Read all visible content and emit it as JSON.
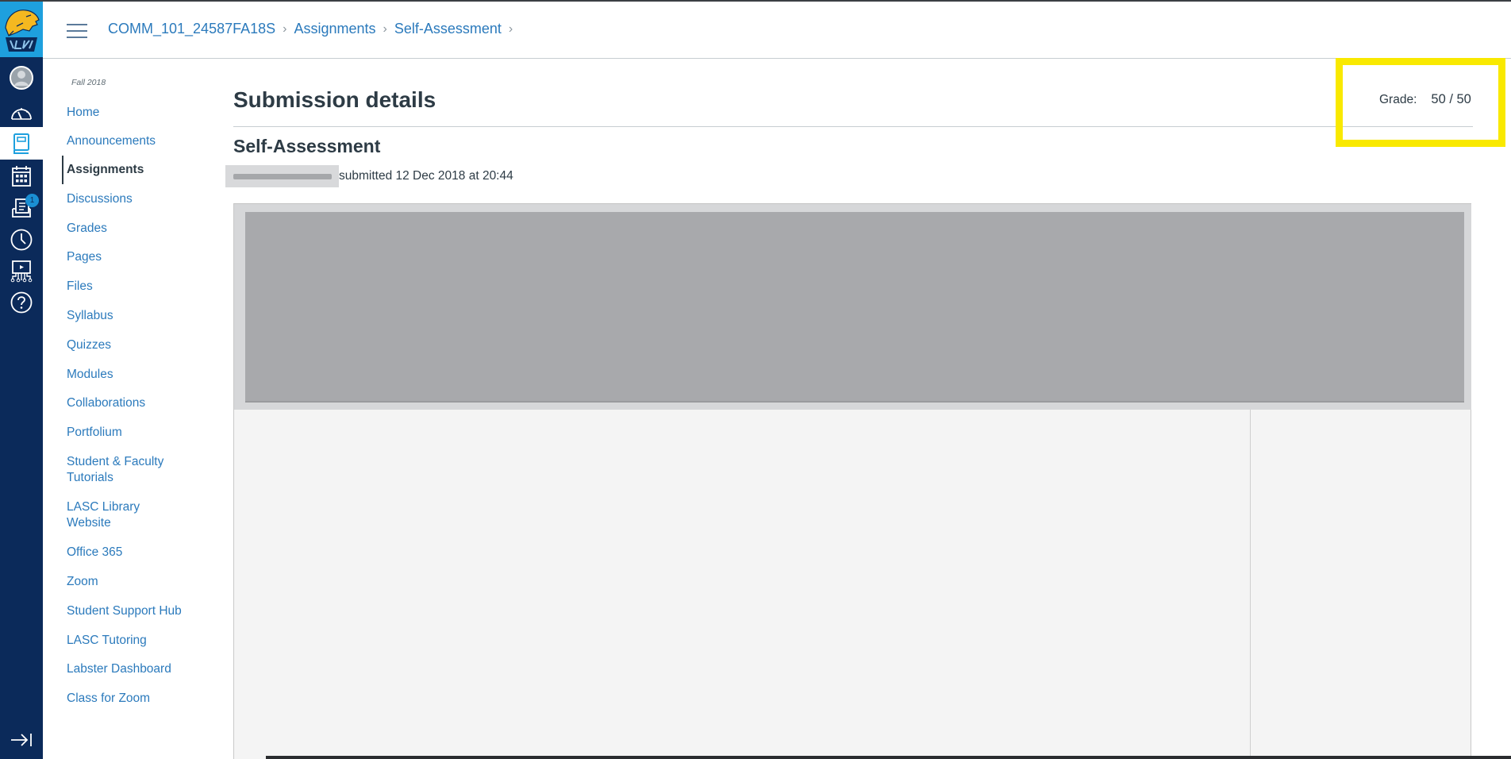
{
  "global_nav": {
    "logo_alt": "LASC logo",
    "items": [
      {
        "name": "account",
        "icon": "user-avatar-icon"
      },
      {
        "name": "dashboard",
        "icon": "speedometer-icon"
      },
      {
        "name": "courses",
        "icon": "book-icon",
        "active": true
      },
      {
        "name": "calendar",
        "icon": "calendar-icon"
      },
      {
        "name": "inbox",
        "icon": "inbox-icon",
        "badge": "1"
      },
      {
        "name": "history",
        "icon": "clock-icon"
      },
      {
        "name": "commons",
        "icon": "presentation-network-icon"
      },
      {
        "name": "help",
        "icon": "help-icon"
      }
    ],
    "collapse_icon": "expand-arrow-icon"
  },
  "header": {
    "breadcrumbs": [
      "COMM_101_24587FA18S",
      "Assignments",
      "Self-Assessment"
    ]
  },
  "course_nav": {
    "term": "Fall 2018",
    "items": [
      {
        "label": "Home"
      },
      {
        "label": "Announcements"
      },
      {
        "label": "Assignments",
        "active": true
      },
      {
        "label": "Discussions"
      },
      {
        "label": "Grades"
      },
      {
        "label": "Pages"
      },
      {
        "label": "Files"
      },
      {
        "label": "Syllabus"
      },
      {
        "label": "Quizzes"
      },
      {
        "label": "Modules"
      },
      {
        "label": "Collaborations"
      },
      {
        "label": "Portfolium"
      },
      {
        "label": "Student & Faculty Tutorials"
      },
      {
        "label": "LASC Library Website"
      },
      {
        "label": "Office 365"
      },
      {
        "label": "Zoom"
      },
      {
        "label": "Student Support Hub"
      },
      {
        "label": "LASC Tutoring"
      },
      {
        "label": "Labster Dashboard"
      },
      {
        "label": "Class for Zoom"
      }
    ]
  },
  "content": {
    "title": "Submission details",
    "assignment_name": "Self-Assessment",
    "submitted_text": "submitted 12 Dec 2018 at 20:44",
    "grade_label": "Grade:",
    "grade_value": "50 / 50"
  },
  "colors": {
    "nav_bg": "#0b2a5a",
    "link": "#2b7abc",
    "highlight": "#f9e900"
  }
}
